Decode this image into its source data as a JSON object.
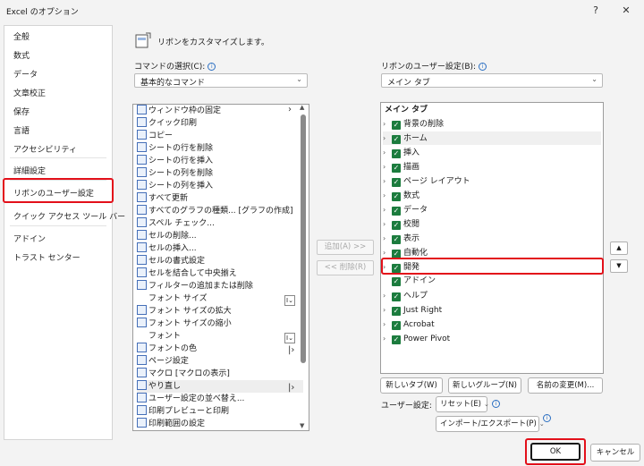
{
  "window": {
    "title": "Excel のオプション",
    "help": "?",
    "close": "✕"
  },
  "sidebar": {
    "items": [
      "全般",
      "数式",
      "データ",
      "文章校正",
      "保存",
      "言語",
      "アクセシビリティ",
      "詳細設定",
      "リボンのユーザー設定",
      "クイック アクセス ツール バー",
      "アドイン",
      "トラスト センター"
    ],
    "selected_index": 8
  },
  "heading": "リボンをカスタマイズします。",
  "commands": {
    "label": "コマンドの選択(C):",
    "dropdown_value": "基本的なコマンド",
    "items": [
      "ウィンドウ枠の固定",
      "クイック印刷",
      "コピー",
      "シートの行を削除",
      "シートの行を挿入",
      "シートの列を削除",
      "シートの列を挿入",
      "すべて更新",
      "すべてのグラフの種類... [グラフの作成]",
      "スペル チェック...",
      "セルの削除...",
      "セルの挿入...",
      "セルの書式設定",
      "セルを結合して中央揃え",
      "フィルターの追加または削除",
      "フォント サイズ",
      "フォント サイズの拡大",
      "フォント サイズの縮小",
      "フォント",
      "フォントの色",
      "ページ設定",
      "マクロ [マクロの表示]",
      "やり直し",
      "ユーザー設定の並べ替え...",
      "印刷プレビューと印刷",
      "印刷範囲の設定"
    ]
  },
  "middle_buttons": {
    "add": "追加(A) >>",
    "remove": "<< 削除(R)"
  },
  "ribbon": {
    "label": "リボンのユーザー設定(B):",
    "dropdown_value": "メイン タブ",
    "header": "メイン タブ",
    "items": [
      "背景の削除",
      "ホーム",
      "挿入",
      "描画",
      "ページ レイアウト",
      "数式",
      "データ",
      "校閲",
      "表示",
      "自動化",
      "開発",
      "アドイン",
      "ヘルプ",
      "Just Right",
      "Acrobat",
      "Power Pivot"
    ],
    "highlighted_index": 10
  },
  "bottom": {
    "new_tab": "新しいタブ(W)",
    "new_group": "新しいグループ(N)",
    "rename": "名前の変更(M)...",
    "user_settings_label": "ユーザー設定:",
    "reset": "リセット(E)",
    "import_export": "インポート/エクスポート(P)"
  },
  "dialog_buttons": {
    "ok": "OK",
    "cancel": "キャンセル"
  },
  "colors": {
    "highlight": "#e3101a",
    "checkbox": "#1c7c3e",
    "accent": "#2b6fc2"
  }
}
